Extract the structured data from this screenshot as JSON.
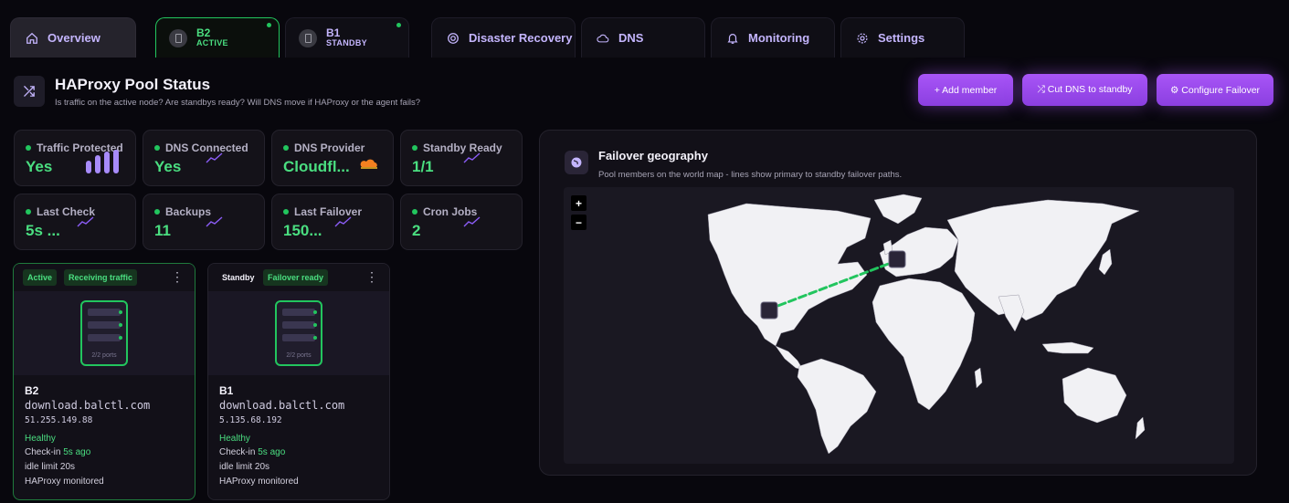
{
  "tabs": {
    "overview": "Overview",
    "b2": {
      "name": "B2",
      "status": "ACTIVE"
    },
    "b1": {
      "name": "B1",
      "status": "STANDBY"
    },
    "disaster_recovery": "Disaster Recovery",
    "dns": "DNS",
    "monitoring": "Monitoring",
    "settings": "Settings"
  },
  "header": {
    "title": "HAProxy Pool Status",
    "subtitle": "Is traffic on the active node? Are standbys ready? Will DNS move if HAProxy or the agent fails?"
  },
  "actions": {
    "add_member": "+ Add member",
    "cut_dns": "⤮ Cut DNS to standby",
    "configure_failover": "⚙ Configure Failover"
  },
  "stats": [
    {
      "label": "Traffic Protected",
      "value": "Yes"
    },
    {
      "label": "DNS Connected",
      "value": "Yes"
    },
    {
      "label": "DNS Provider",
      "value": "Cloudfl..."
    },
    {
      "label": "Standby Ready",
      "value": "1/1"
    },
    {
      "label": "Last Check",
      "value": "5s ..."
    },
    {
      "label": "Backups",
      "value": "11"
    },
    {
      "label": "Last Failover",
      "value": "150..."
    },
    {
      "label": "Cron Jobs",
      "value": "2"
    }
  ],
  "cards": [
    {
      "badge1": "Active",
      "badge2": "Receiving traffic",
      "ports": "2/2 ports",
      "name": "B2",
      "host": "download.balctl.com",
      "ip": "51.255.149.88",
      "health": "Healthy",
      "checkin_prefix": "Check-in ",
      "checkin_value": "5s ago",
      "idle": "idle limit 20s",
      "monitor": "HAProxy monitored"
    },
    {
      "badge1": "Standby",
      "badge2": "Failover ready",
      "ports": "2/2 ports",
      "name": "B1",
      "host": "download.balctl.com",
      "ip": "5.135.68.192",
      "health": "Healthy",
      "checkin_prefix": "Check-in ",
      "checkin_value": "5s ago",
      "idle": "idle limit 20s",
      "monitor": "HAProxy monitored"
    }
  ],
  "geo": {
    "title": "Failover geography",
    "subtitle": "Pool members on the world map - lines show primary to standby failover paths.",
    "zoom_in": "+",
    "zoom_out": "−"
  },
  "colors": {
    "accent": "#a855f7",
    "active": "#22c55e",
    "text_muted": "#a6a3b4"
  }
}
